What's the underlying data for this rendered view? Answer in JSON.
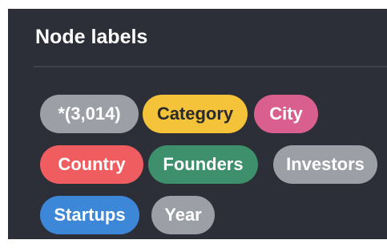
{
  "panel": {
    "title": "Node labels"
  },
  "labels": [
    {
      "id": "all",
      "text": "*(3,014)",
      "color": "#9d9fa6",
      "text_color": "#ffffff"
    },
    {
      "id": "category",
      "text": "Category",
      "color": "#f5c339",
      "text_color": "#2a2a2a"
    },
    {
      "id": "city",
      "text": "City",
      "color": "#d9608e",
      "text_color": "#ffffff"
    },
    {
      "id": "country",
      "text": "Country",
      "color": "#ef5d60",
      "text_color": "#ffffff"
    },
    {
      "id": "founders",
      "text": "Founders",
      "color": "#3e8f6c",
      "text_color": "#ffffff"
    },
    {
      "id": "investors",
      "text": "Investors",
      "color": "#9d9fa6",
      "text_color": "#ffffff"
    },
    {
      "id": "startups",
      "text": "Startups",
      "color": "#3d87d8",
      "text_color": "#ffffff"
    },
    {
      "id": "year",
      "text": "Year",
      "color": "#9d9fa6",
      "text_color": "#ffffff"
    }
  ]
}
